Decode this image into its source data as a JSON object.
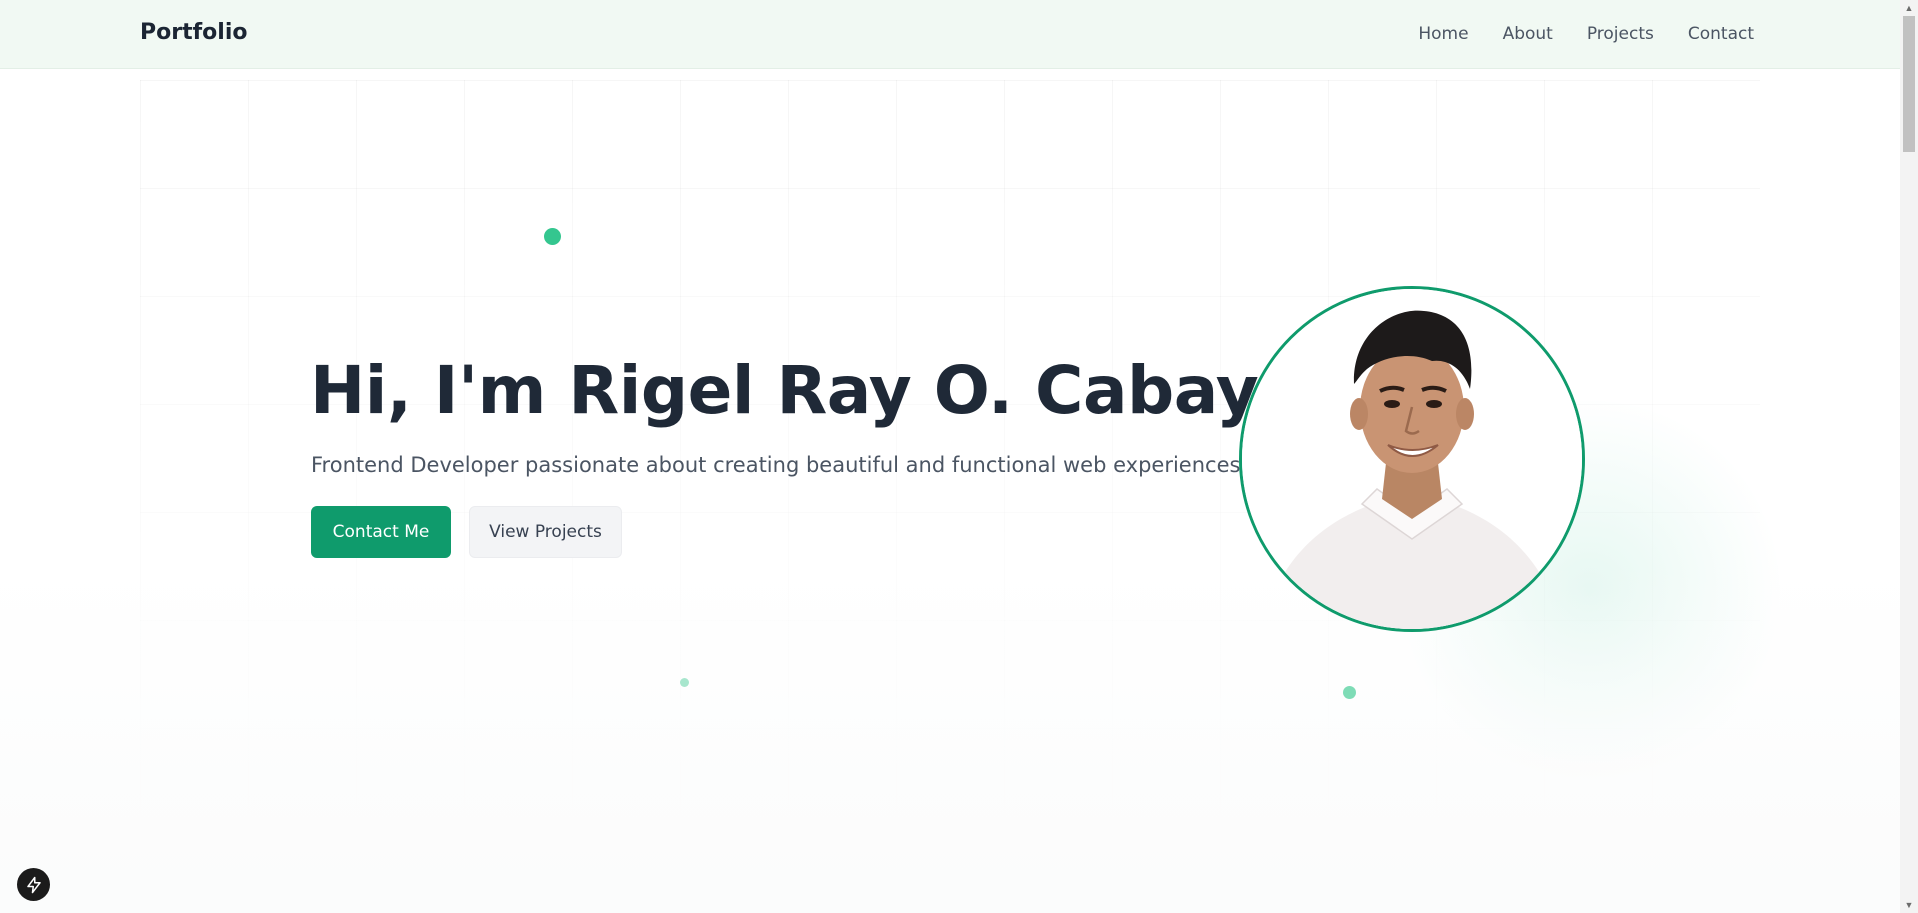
{
  "header": {
    "brand": "Portfolio",
    "nav": [
      "Home",
      "About",
      "Projects",
      "Contact"
    ]
  },
  "hero": {
    "title": "Hi, I'm Rigel Ray O. Cabaya",
    "subtitle": "Frontend Developer passionate about creating beautiful and functional web experiences",
    "primary_button": "Contact Me",
    "secondary_button": "View Projects"
  },
  "icons": {
    "dev_badge": "bolt-icon",
    "scroll_up": "arrow-up-icon",
    "scroll_down": "arrow-down-icon"
  },
  "colors": {
    "accent": "#0f9b6c",
    "header_bg": "#f1f9f3",
    "title": "#1f2937",
    "dot": "#34c68f"
  }
}
